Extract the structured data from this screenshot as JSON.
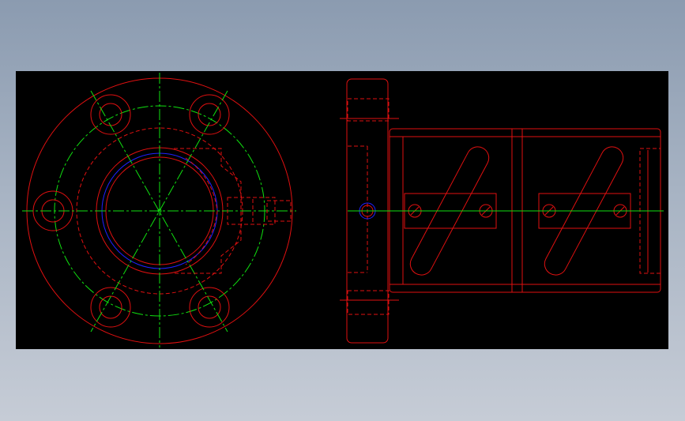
{
  "drawing": {
    "background": "#000000",
    "page_background": "#97a6b8",
    "colors": {
      "outline": "#e01010",
      "center_line": "#10e010",
      "highlight": "#2020ff"
    },
    "views": [
      {
        "name": "front-view",
        "shape": "flange with 4 bolt holes"
      },
      {
        "name": "side-view",
        "shape": "flange with coupling body and slotted sleeves"
      }
    ]
  }
}
